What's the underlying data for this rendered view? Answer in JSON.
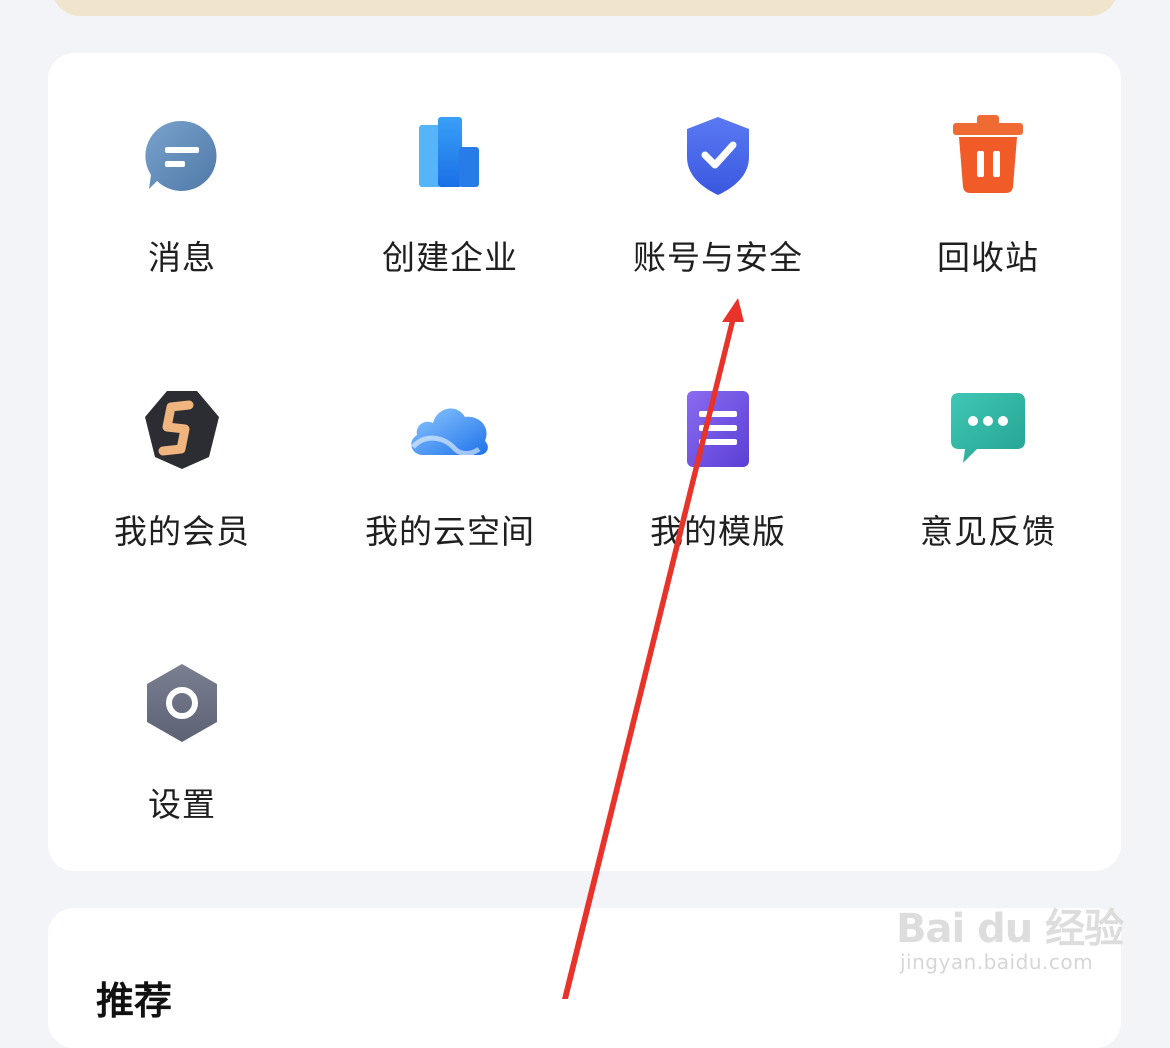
{
  "menu": {
    "items": [
      {
        "label": "消息",
        "icon": "message-icon"
      },
      {
        "label": "创建企业",
        "icon": "create-enterprise-icon"
      },
      {
        "label": "账号与安全",
        "icon": "shield-check-icon"
      },
      {
        "label": "回收站",
        "icon": "trash-icon"
      },
      {
        "label": "我的会员",
        "icon": "membership-icon"
      },
      {
        "label": "我的云空间",
        "icon": "cloud-icon"
      },
      {
        "label": "我的模版",
        "icon": "template-icon"
      },
      {
        "label": "意见反馈",
        "icon": "chat-feedback-icon"
      },
      {
        "label": "设置",
        "icon": "settings-icon"
      }
    ]
  },
  "recommend": {
    "title": "推荐"
  },
  "watermark": {
    "main": "Bai du 经验",
    "sub": "jingyan.baidu.com"
  },
  "colors": {
    "background": "#f3f4f8",
    "card": "#ffffff",
    "banner": "#f1e4cc",
    "annotation_arrow": "#e8322a"
  }
}
